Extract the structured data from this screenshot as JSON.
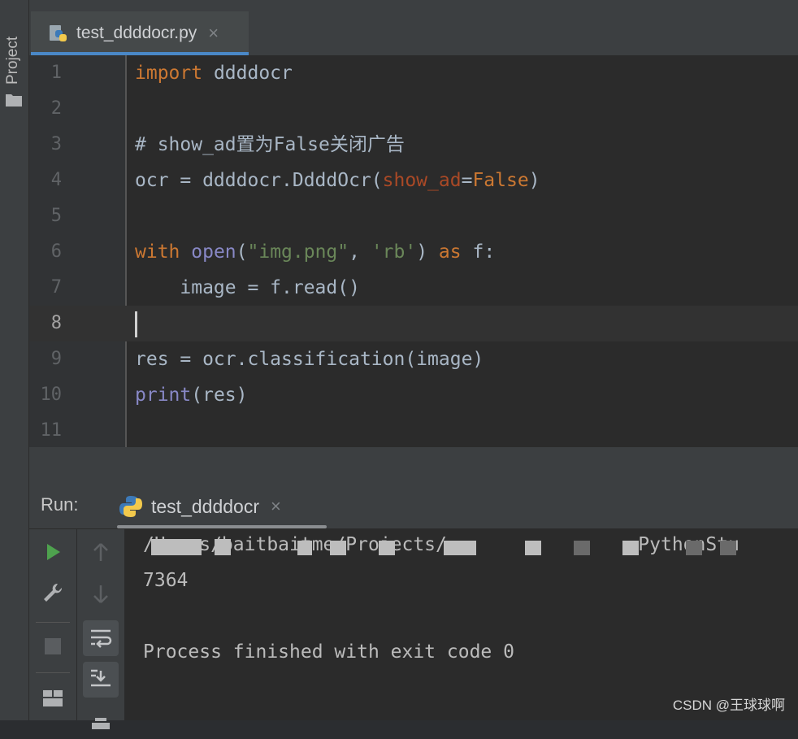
{
  "left_panel": {
    "project_label": "Project"
  },
  "editor_tab": {
    "filename": "test_ddddocr.py"
  },
  "editor": {
    "current_line": 8,
    "lines": [
      {
        "number": "1",
        "text": "import ddddocr"
      },
      {
        "number": "2",
        "text": ""
      },
      {
        "number": "3",
        "text": "# show_ad置为False关闭广告"
      },
      {
        "number": "4",
        "text": "ocr = ddddocr.DdddOcr(show_ad=False)"
      },
      {
        "number": "5",
        "text": ""
      },
      {
        "number": "6",
        "text": "with open(\"img.png\", 'rb') as f:"
      },
      {
        "number": "7",
        "text": "    image = f.read()"
      },
      {
        "number": "8",
        "text": ""
      },
      {
        "number": "9",
        "text": "res = ocr.classification(image)"
      },
      {
        "number": "10",
        "text": "print(res)"
      },
      {
        "number": "11",
        "text": ""
      }
    ]
  },
  "run_panel": {
    "label": "Run:",
    "tab_name": "test_ddddocr",
    "console": {
      "path_line": "/Users/baitbaitme/Projects/                 PythonStu",
      "output": "7364",
      "exit_message": "Process finished with exit code 0"
    }
  },
  "watermark": "CSDN @王球球啊",
  "colors": {
    "keyword": "#cc7832",
    "comment": "#808080",
    "string": "#6a8759",
    "builtin": "#8888c6",
    "param": "#aa4926",
    "run_green": "#4ea24e",
    "tab_accent": "#4a88c7"
  }
}
